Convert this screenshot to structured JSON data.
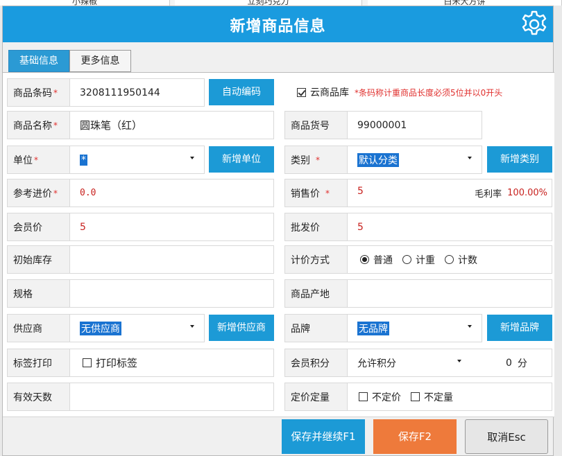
{
  "background_items": [
    "小辣椒",
    "立刻巧克力",
    "白米大方饼"
  ],
  "dialog": {
    "title": "新增商品信息",
    "settings_icon": "gear-icon"
  },
  "tabs": [
    {
      "label": "基础信息",
      "active": true
    },
    {
      "label": "更多信息",
      "active": false
    }
  ],
  "form": {
    "barcode": {
      "label": "商品条码",
      "required": "*",
      "value": "3208111950144",
      "button": "自动编码"
    },
    "cloud_library": {
      "label": "云商品库",
      "checked": true,
      "note": "*条码称计重商品长度必须5位并以0开头"
    },
    "name": {
      "label": "商品名称",
      "required": "*",
      "value": "圆珠笔（红）"
    },
    "item_no": {
      "label": "商品货号",
      "value": "99000001"
    },
    "unit": {
      "label": "单位",
      "required": "*",
      "value": "*",
      "button": "新增单位"
    },
    "category": {
      "label": "类别",
      "required": "*",
      "value": "默认分类",
      "button": "新增类别"
    },
    "purchase_price": {
      "label": "参考进价",
      "required": "*",
      "value": "0.0"
    },
    "sale_price": {
      "label": "销售价",
      "required": "*",
      "value": "5",
      "margin_label": "毛利率",
      "margin_value": "100.00%"
    },
    "member_price": {
      "label": "会员价",
      "value": "5"
    },
    "wholesale_price": {
      "label": "批发价",
      "value": "5"
    },
    "initial_stock": {
      "label": "初始库存",
      "value": ""
    },
    "pricing_method": {
      "label": "计价方式",
      "options": [
        "普通",
        "计重",
        "计数"
      ],
      "selected": "普通"
    },
    "spec": {
      "label": "规格",
      "value": ""
    },
    "origin": {
      "label": "商品产地",
      "value": ""
    },
    "supplier": {
      "label": "供应商",
      "value": "无供应商",
      "button": "新增供应商"
    },
    "brand": {
      "label": "品牌",
      "value": "无品牌",
      "button": "新增品牌"
    },
    "label_print": {
      "label": "标签打印",
      "checkbox": "打印标签",
      "checked": false
    },
    "member_points": {
      "label": "会员积分",
      "value": "允许积分",
      "points": "0",
      "unit": "分"
    },
    "shelf_days": {
      "label": "有效天数",
      "value": ""
    },
    "fixed": {
      "label": "定价定量",
      "opt1": "不定价",
      "opt2": "不定量"
    }
  },
  "footer": {
    "save_continue": "保存并继续F1",
    "save": "保存F2",
    "cancel": "取消Esc"
  },
  "colors": {
    "title_bar": "#1a9bdf",
    "primary_button": "#1c9ad6",
    "save_button": "#ee7a3b",
    "required": "#e0302e"
  }
}
